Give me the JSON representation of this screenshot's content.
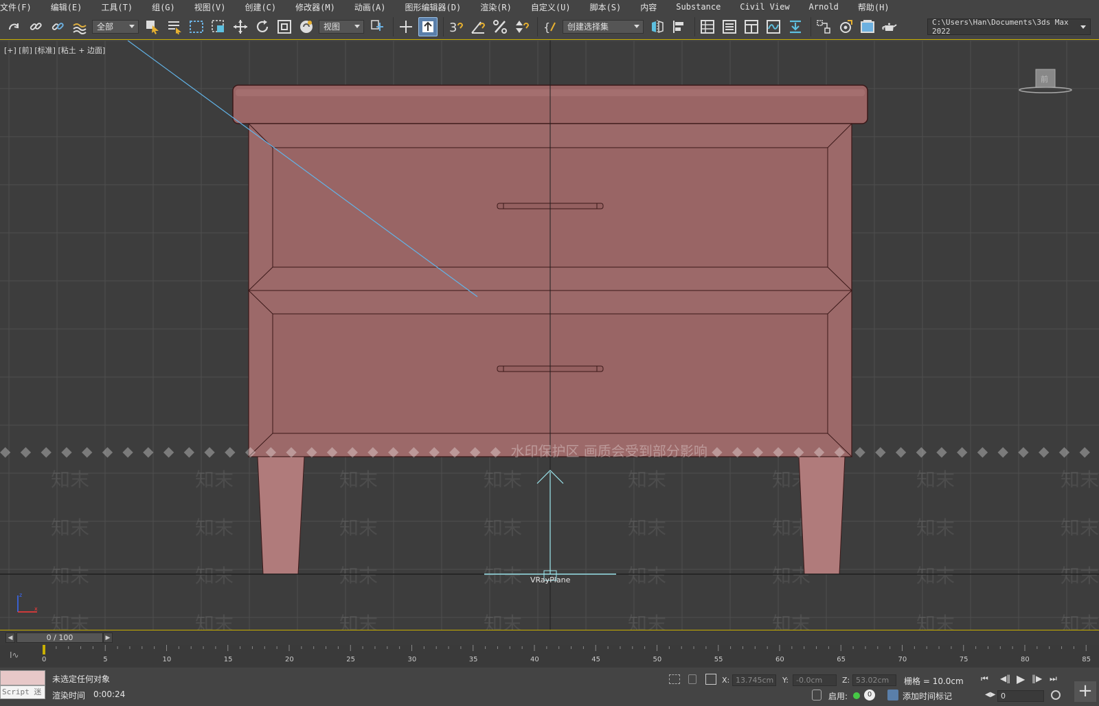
{
  "menu": [
    "文件(F)",
    "编辑(E)",
    "工具(T)",
    "组(G)",
    "视图(V)",
    "创建(C)",
    "修改器(M)",
    "动画(A)",
    "图形编辑器(D)",
    "渲染(R)",
    "自定义(U)",
    "脚本(S)",
    "内容",
    "Substance",
    "Civil View",
    "Arnold",
    "帮助(H)"
  ],
  "toolbar": {
    "selection_filter": "全部",
    "reference_coord": "视图",
    "named_selection": "创建选择集",
    "project_path": "C:\\Users\\Han\\Documents\\3ds Max 2022",
    "snap_label": "3"
  },
  "viewport": {
    "label": "[+] [前] [标准] [粘土 + 边面]",
    "watermark_banner": "水印保护区   画质会受到部分影响",
    "watermark_text": "知末",
    "object_label": "VRayPlane",
    "viewcube_label": "前"
  },
  "timeline": {
    "frame_display": "0 / 100",
    "ticks": [
      0,
      5,
      10,
      15,
      20,
      25,
      30,
      35,
      40,
      45,
      50,
      55,
      60,
      65,
      70,
      75,
      80,
      85
    ]
  },
  "status": {
    "maxscript_label": "Script 迷",
    "selection_status": "未选定任何对象",
    "render_time_label": "渲染时间",
    "render_time_value": "0:00:24",
    "x_label": "X:",
    "x_value": "13.745cm",
    "y_label": "Y:",
    "y_value": "-0.0cm",
    "z_label": "Z:",
    "z_value": "53.02cm",
    "grid": "栅格 = 10.0cm",
    "enable_label": "启用:",
    "add_time_tag": "添加时间标记",
    "current_frame": "0"
  },
  "colors": {
    "accent_yellow": "#c9b000",
    "model_fill": "#9a6868",
    "selection_blue": "#5a7faa",
    "wire_cyan": "#9ee8f0"
  }
}
